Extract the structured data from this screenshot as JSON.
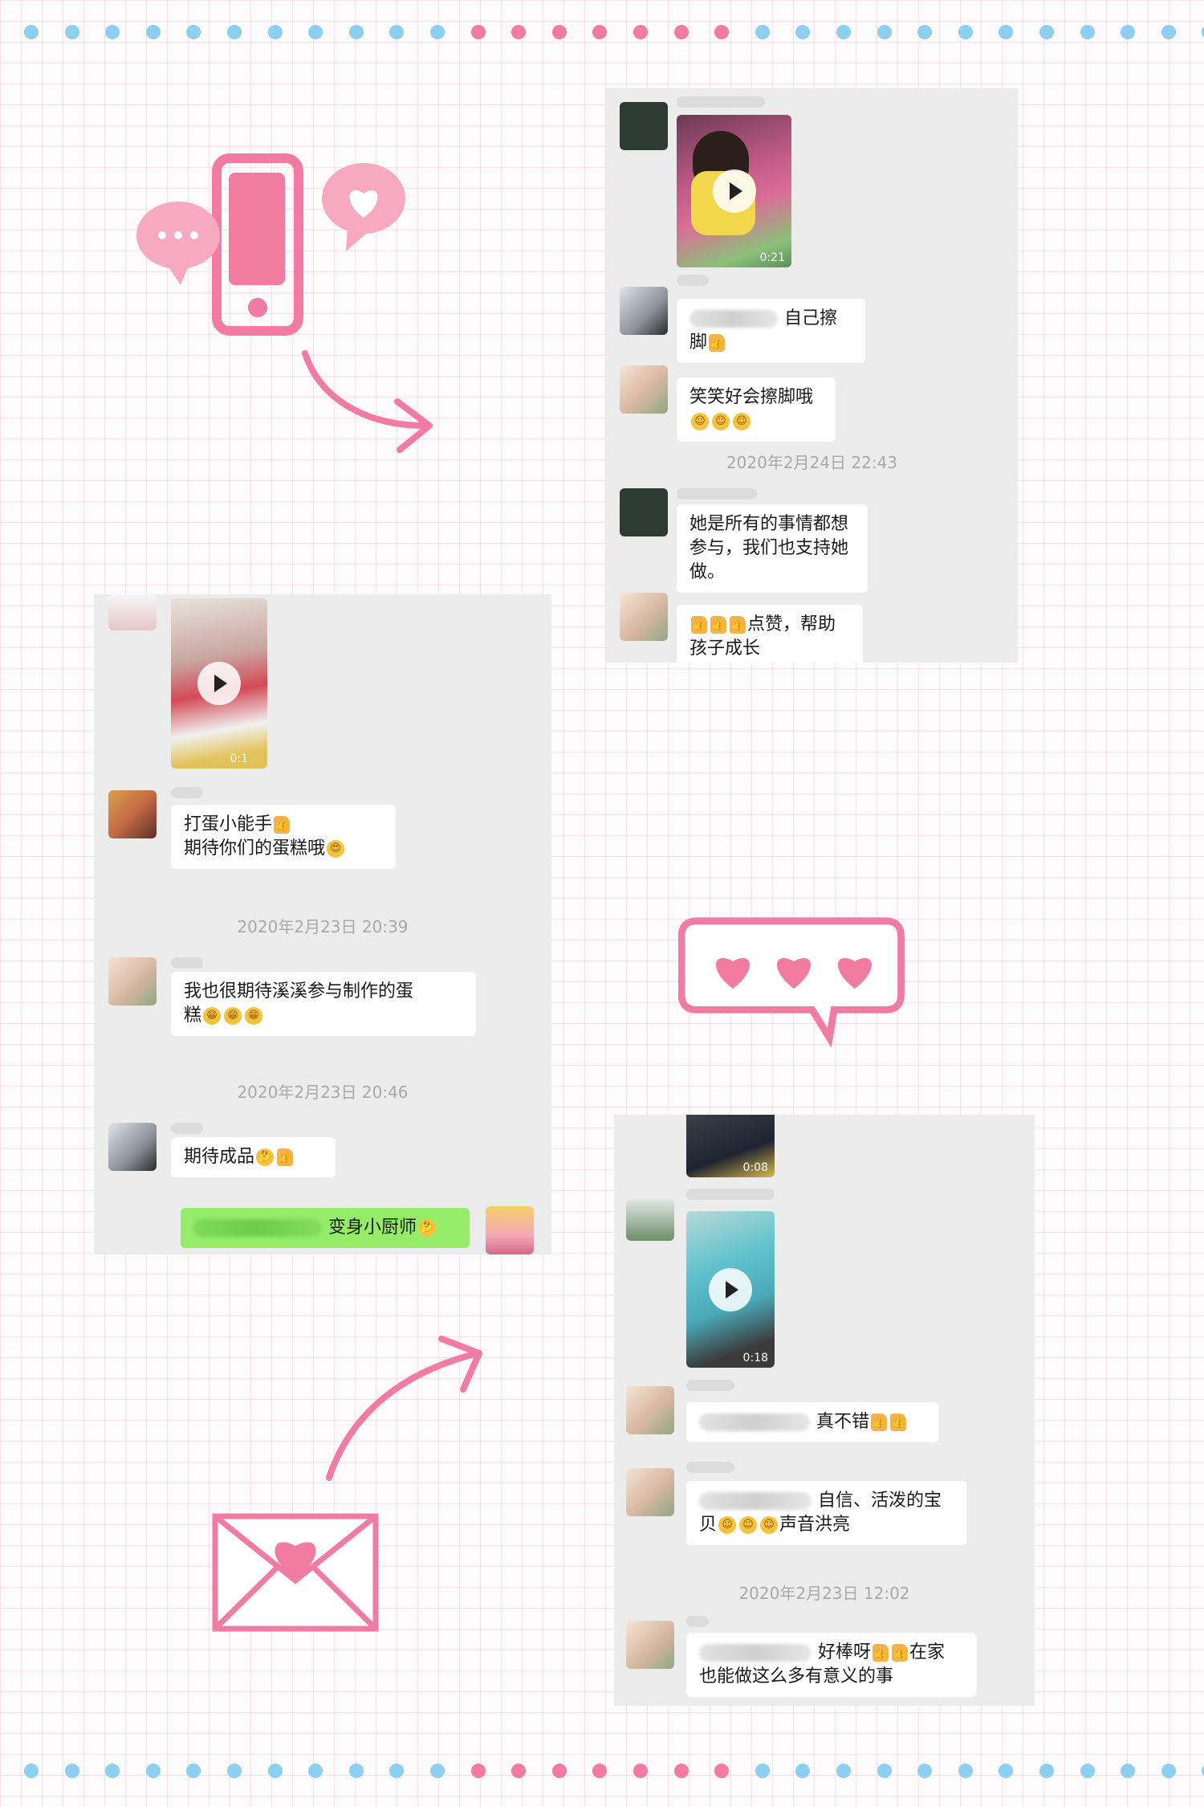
{
  "colors": {
    "pink": "#f27ba2",
    "blue": "#8ccff0",
    "chat_bg": "#ececec",
    "bubble_green": "#95ec69"
  },
  "decor": {
    "top_dot_colors": [
      "blue",
      "blue",
      "blue",
      "blue",
      "blue",
      "blue",
      "blue",
      "blue",
      "blue",
      "blue",
      "blue",
      "pink",
      "pink",
      "pink",
      "pink",
      "pink",
      "pink",
      "pink",
      "blue",
      "blue",
      "blue",
      "blue",
      "blue",
      "blue",
      "blue",
      "blue",
      "blue",
      "blue",
      "blue",
      "blue"
    ],
    "icons": [
      "phone-chat-icon",
      "arrow-curved-right-icon",
      "hearts-speech-bubble-icon",
      "arrow-curved-up-icon",
      "love-envelope-icon"
    ]
  },
  "chat1": {
    "video": {
      "duration": "0:21"
    },
    "msg1": {
      "text": "自己擦脚"
    },
    "msg2": {
      "text": "笑笑好会擦脚哦"
    },
    "time1": "2020年2月24日 22:43",
    "msg3": {
      "text": "她是所有的事情都想参与，我们也支持她做。"
    },
    "msg4": {
      "text": "点赞，帮助孩子成长"
    }
  },
  "chat2": {
    "video": {
      "duration": "0:1"
    },
    "msg1": {
      "line1": "打蛋小能手",
      "line2": "期待你们的蛋糕哦"
    },
    "time1": "2020年2月23日 20:39",
    "msg2": {
      "line1": "我也很期待溪溪参与制作的蛋",
      "line2": "糕"
    },
    "time2": "2020年2月23日 20:46",
    "msg3": {
      "text": "期待成品"
    },
    "msg4": {
      "text": "变身小厨师"
    }
  },
  "chat3": {
    "video1": {
      "duration": "0:08"
    },
    "video2": {
      "duration": "0:18"
    },
    "msg1": {
      "text": "真不错"
    },
    "msg2": {
      "line1": "自信、活泼的宝",
      "line2": "贝",
      "line2b": "声音洪亮"
    },
    "time1": "2020年2月23日 12:02",
    "msg3": {
      "line1a": "好棒呀",
      "line1b": "在家",
      "line2": "也能做这么多有意义的事"
    }
  }
}
